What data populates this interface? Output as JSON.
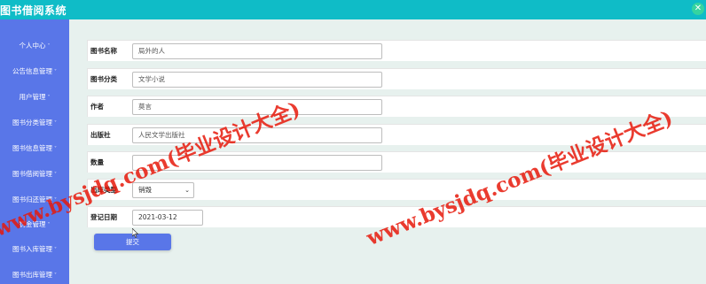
{
  "app": {
    "title": "图书借阅系统",
    "close_icon": "close-icon"
  },
  "sidebar": {
    "items": [
      {
        "label": "个人中心"
      },
      {
        "label": "公告信息管理"
      },
      {
        "label": "用户管理"
      },
      {
        "label": "图书分类管理"
      },
      {
        "label": "图书信息管理"
      },
      {
        "label": "图书借阅管理"
      },
      {
        "label": "图书归还管理"
      },
      {
        "label": "罚金管理"
      },
      {
        "label": "图书入库管理"
      },
      {
        "label": "图书出库管理"
      }
    ],
    "chevron": "˅"
  },
  "form": {
    "fields": [
      {
        "label": "图书名称",
        "value": "局外的人"
      },
      {
        "label": "图书分类",
        "value": "文学小说"
      },
      {
        "label": "作者",
        "value": "莫言"
      },
      {
        "label": "出版社",
        "value": "人民文学出版社"
      },
      {
        "label": "数量",
        "value": ""
      },
      {
        "label": "出库类型",
        "value": "销毁"
      },
      {
        "label": "登记日期",
        "value": "2021-03-12"
      }
    ],
    "submit_label": "提交"
  },
  "watermarks": [
    {
      "text": "www.bysjdq.com(毕业设计大全)"
    },
    {
      "text": "www.bysjdq.com(毕业设计大全)"
    }
  ],
  "colors": {
    "topbar": "#0fbcc7",
    "sidebar": "#5976e8",
    "accent": "#5976e8",
    "watermark": "#e6190a"
  }
}
